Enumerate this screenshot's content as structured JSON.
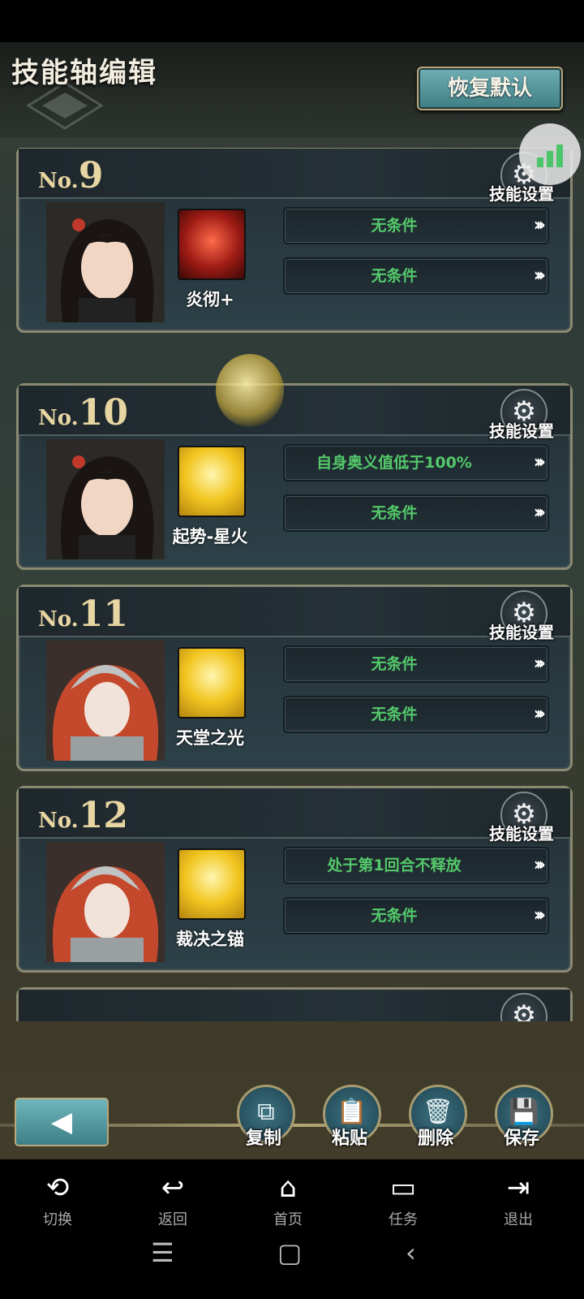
{
  "header": {
    "title": "技能轴编辑",
    "reset_label": "恢复默认"
  },
  "cards": [
    {
      "prefix": "No.",
      "number": "9",
      "gear_label": "技能设置",
      "skill_name": "炎彻+",
      "icon": "flame-sword-skill-icon",
      "conditions": [
        "无条件",
        "无条件"
      ]
    },
    {
      "prefix": "No.",
      "number": "10",
      "gear_label": "技能设置",
      "skill_name": "起势-星火",
      "icon": "golden-warrior-skill-icon",
      "conditions": [
        "自身奥义值低于100%",
        "无条件"
      ]
    },
    {
      "prefix": "No.",
      "number": "11",
      "gear_label": "技能设置",
      "skill_name": "天堂之光",
      "icon": "golden-warrior-skill-icon",
      "conditions": [
        "无条件",
        "无条件"
      ]
    },
    {
      "prefix": "No.",
      "number": "12",
      "gear_label": "技能设置",
      "skill_name": "裁决之锚",
      "icon": "golden-warrior-skill-icon",
      "conditions": [
        "处于第1回合不释放",
        "无条件"
      ]
    }
  ],
  "actions": {
    "copy": "复制",
    "paste": "粘贴",
    "delete": "删除",
    "save": "保存"
  },
  "nav": {
    "switch": "切换",
    "back": "返回",
    "home": "首页",
    "tasks": "任务",
    "exit": "退出"
  },
  "colors": {
    "condition_text": "#54c86a",
    "card_border": "#8a8a72",
    "accent_teal": "#4f9aa2",
    "number_gold": "#e8d6a2"
  }
}
